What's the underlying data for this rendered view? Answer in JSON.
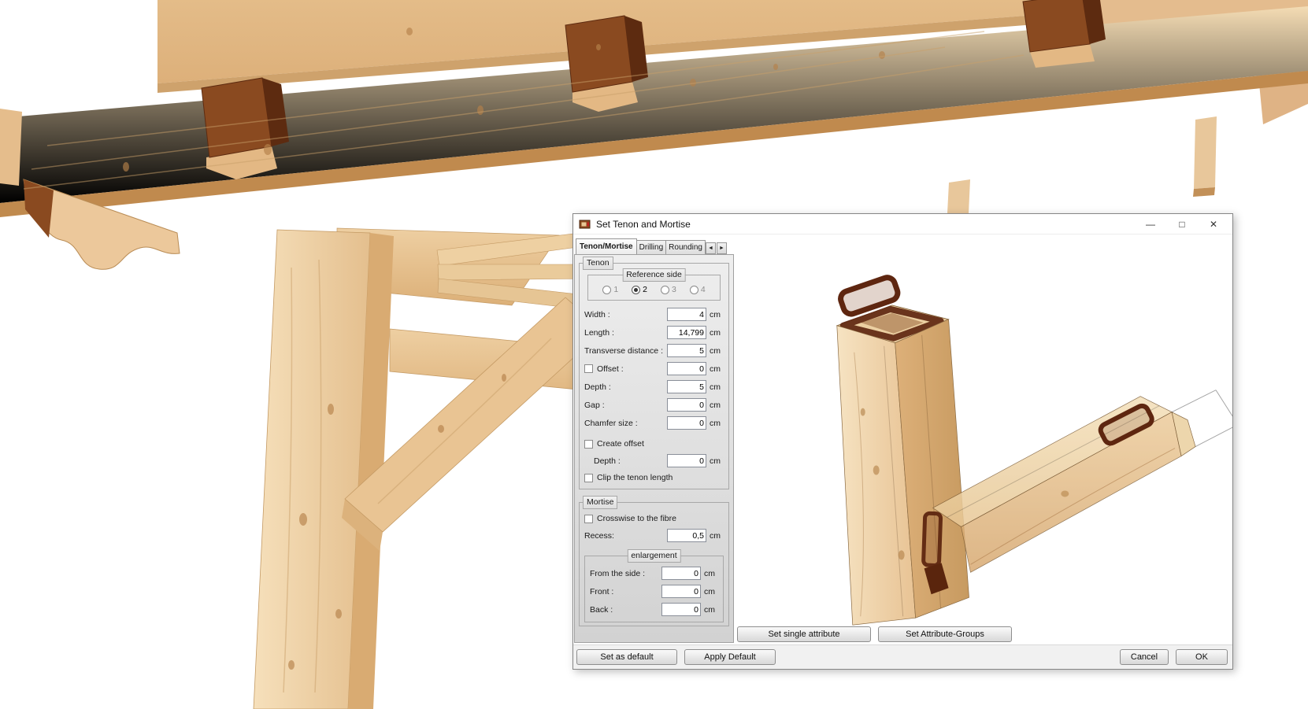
{
  "window": {
    "title": "Set Tenon and Mortise",
    "controls": {
      "minimize": "—",
      "maximize": "□",
      "close": "✕"
    }
  },
  "tabs": {
    "items": [
      {
        "label": "Tenon/Mortise",
        "active": true
      },
      {
        "label": "Drilling",
        "active": false
      },
      {
        "label": "Rounding",
        "active": false
      }
    ],
    "scroll_left": "◄",
    "scroll_right": "►"
  },
  "tenon": {
    "group_label": "Tenon",
    "reference": {
      "group_label": "Reference side",
      "options": [
        "1",
        "2",
        "3",
        "4"
      ],
      "selected": "2"
    },
    "width": {
      "label": "Width :",
      "value": "4",
      "unit": "cm"
    },
    "length": {
      "label": "Length :",
      "value": "14,799",
      "unit": "cm"
    },
    "transverse": {
      "label": "Transverse distance :",
      "value": "5",
      "unit": "cm"
    },
    "offset": {
      "label": "Offset :",
      "value": "0",
      "unit": "cm",
      "checked": false
    },
    "depth": {
      "label": "Depth :",
      "value": "5",
      "unit": "cm"
    },
    "gap": {
      "label": "Gap :",
      "value": "0",
      "unit": "cm"
    },
    "chamfer": {
      "label": "Chamfer size :",
      "value": "0",
      "unit": "cm"
    },
    "create_offset": {
      "label": "Create offset",
      "checked": false
    },
    "offset_depth": {
      "label": "Depth :",
      "value": "0",
      "unit": "cm"
    },
    "clip": {
      "label": "Clip the tenon length",
      "checked": false
    }
  },
  "mortise": {
    "group_label": "Mortise",
    "crosswise": {
      "label": "Crosswise to the fibre",
      "checked": false
    },
    "recess": {
      "label": "Recess:",
      "value": "0,5",
      "unit": "cm"
    },
    "enlargement": {
      "group_label": "enlargement",
      "from_side": {
        "label": "From the side :",
        "value": "0",
        "unit": "cm"
      },
      "front": {
        "label": "Front :",
        "value": "0",
        "unit": "cm"
      },
      "back": {
        "label": "Back :",
        "value": "0",
        "unit": "cm"
      }
    }
  },
  "buttons": {
    "set_single": "Set single attribute",
    "set_groups": "Set Attribute-Groups",
    "set_default": "Set as default",
    "apply_default": "Apply Default",
    "cancel": "Cancel",
    "ok": "OK"
  },
  "colors": {
    "wood_light": "#f2d8ae",
    "wood_base": "#e8c394",
    "wood_dark": "#c4925a",
    "end_grain": "#8a4a20",
    "end_grain_dark": "#5d2b10",
    "panel_bg": "#e0e0e0",
    "dialog_border": "#868686"
  }
}
